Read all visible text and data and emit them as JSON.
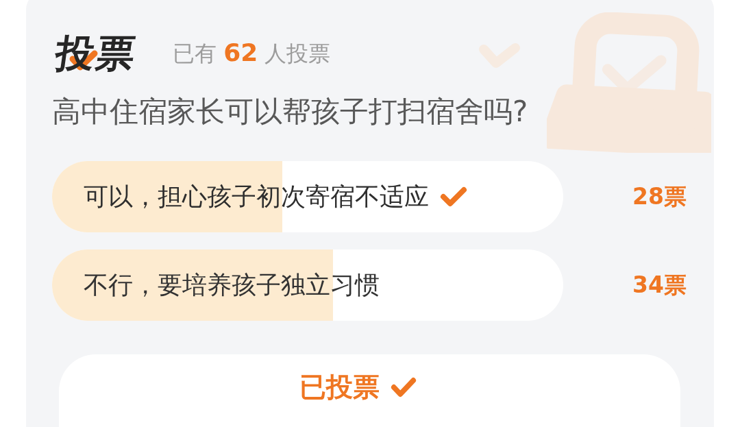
{
  "header": {
    "logo": "投票",
    "vote_summary": "已有 **62** 人投票"
  },
  "question": "高中住宿家长可以帮孩子打扫宿舍吗?",
  "options": [
    {
      "label": "可以，担心孩子初次寄宿不适应",
      "selected": true,
      "level": 0.45,
      "votes": "28票"
    },
    {
      "label": "不行，要培养孩子独立习惯",
      "selected": false,
      "level": 0.55,
      "votes": "34票"
    }
  ],
  "vote_button": {
    "label": "已投票",
    "voted": true
  }
}
